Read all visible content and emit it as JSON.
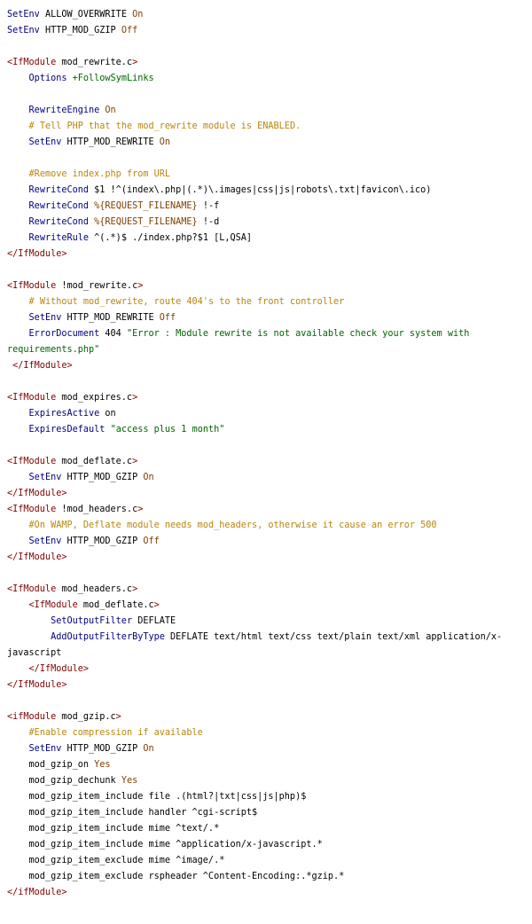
{
  "code": {
    "lines": [
      [
        [
          "d",
          "SetEnv"
        ],
        [
          "p",
          " ALLOW_OVERWRITE "
        ],
        [
          "o",
          "On"
        ]
      ],
      [
        [
          "d",
          "SetEnv"
        ],
        [
          "p",
          " HTTP_MOD_GZIP "
        ],
        [
          "o",
          "Off"
        ]
      ],
      [],
      [
        [
          "t",
          "<IfModule"
        ],
        [
          "p",
          " mod_rewrite.c"
        ],
        [
          "t",
          ">"
        ]
      ],
      [
        [
          "p",
          "    "
        ],
        [
          "d",
          "Options"
        ],
        [
          "p",
          " "
        ],
        [
          "s",
          "+FollowSymLinks"
        ]
      ],
      [],
      [
        [
          "p",
          "    "
        ],
        [
          "d",
          "RewriteEngine"
        ],
        [
          "p",
          " "
        ],
        [
          "o",
          "On"
        ]
      ],
      [
        [
          "p",
          "    "
        ],
        [
          "c",
          "# Tell PHP that the mod_rewrite module is ENABLED."
        ]
      ],
      [
        [
          "p",
          "    "
        ],
        [
          "d",
          "SetEnv"
        ],
        [
          "p",
          " HTTP_MOD_REWRITE "
        ],
        [
          "o",
          "On"
        ]
      ],
      [],
      [
        [
          "p",
          "    "
        ],
        [
          "c",
          "#Remove index.php from URL"
        ]
      ],
      [
        [
          "p",
          "    "
        ],
        [
          "d",
          "RewriteCond"
        ],
        [
          "p",
          " $1 !^(index\\.php|(.*)\\.images|css|js|robots\\.txt|favicon\\.ico)"
        ]
      ],
      [
        [
          "p",
          "    "
        ],
        [
          "d",
          "RewriteCond"
        ],
        [
          "p",
          " "
        ],
        [
          "o",
          "%{REQUEST_FILENAME}"
        ],
        [
          "p",
          " !-f"
        ]
      ],
      [
        [
          "p",
          "    "
        ],
        [
          "d",
          "RewriteCond"
        ],
        [
          "p",
          " "
        ],
        [
          "o",
          "%{REQUEST_FILENAME}"
        ],
        [
          "p",
          " !-d"
        ]
      ],
      [
        [
          "p",
          "    "
        ],
        [
          "d",
          "RewriteRule"
        ],
        [
          "p",
          " ^(.*)$ ./index.php?$1 [L,QSA]"
        ]
      ],
      [
        [
          "t",
          "</IfModule>"
        ]
      ],
      [],
      [
        [
          "t",
          "<IfModule"
        ],
        [
          "p",
          " !mod_rewrite.c"
        ],
        [
          "t",
          ">"
        ]
      ],
      [
        [
          "p",
          "    "
        ],
        [
          "c",
          "# Without mod_rewrite, route 404's to the front controller"
        ]
      ],
      [
        [
          "p",
          "    "
        ],
        [
          "d",
          "SetEnv"
        ],
        [
          "p",
          " HTTP_MOD_REWRITE "
        ],
        [
          "o",
          "Off"
        ]
      ],
      [
        [
          "p",
          "    "
        ],
        [
          "d",
          "ErrorDocument"
        ],
        [
          "p",
          " 404 "
        ],
        [
          "s",
          "\"Error : Module rewrite is not available check your system with"
        ]
      ],
      [
        [
          "s",
          "requirements.php\""
        ]
      ],
      [
        [
          "p",
          " "
        ],
        [
          "t",
          "</IfModule>"
        ]
      ],
      [],
      [
        [
          "t",
          "<IfModule"
        ],
        [
          "p",
          " mod_expires.c"
        ],
        [
          "t",
          ">"
        ]
      ],
      [
        [
          "p",
          "    "
        ],
        [
          "d",
          "ExpiresActive"
        ],
        [
          "p",
          " on"
        ]
      ],
      [
        [
          "p",
          "    "
        ],
        [
          "d",
          "ExpiresDefault"
        ],
        [
          "p",
          " "
        ],
        [
          "s",
          "\"access plus 1 month\""
        ]
      ],
      [],
      [
        [
          "t",
          "<IfModule"
        ],
        [
          "p",
          " mod_deflate.c"
        ],
        [
          "t",
          ">"
        ]
      ],
      [
        [
          "p",
          "    "
        ],
        [
          "d",
          "SetEnv"
        ],
        [
          "p",
          " HTTP_MOD_GZIP "
        ],
        [
          "o",
          "On"
        ]
      ],
      [
        [
          "t",
          "</IfModule>"
        ]
      ],
      [
        [
          "t",
          "<IfModule"
        ],
        [
          "p",
          " !mod_headers.c"
        ],
        [
          "t",
          ">"
        ]
      ],
      [
        [
          "p",
          "    "
        ],
        [
          "c",
          "#On WAMP, Deflate module needs mod_headers, otherwise it cause an error 500"
        ]
      ],
      [
        [
          "p",
          "    "
        ],
        [
          "d",
          "SetEnv"
        ],
        [
          "p",
          " HTTP_MOD_GZIP "
        ],
        [
          "o",
          "Off"
        ]
      ],
      [
        [
          "t",
          "</IfModule>"
        ]
      ],
      [],
      [
        [
          "t",
          "<IfModule"
        ],
        [
          "p",
          " mod_headers.c"
        ],
        [
          "t",
          ">"
        ]
      ],
      [
        [
          "p",
          "    "
        ],
        [
          "t",
          "<IfModule"
        ],
        [
          "p",
          " mod_deflate.c"
        ],
        [
          "t",
          ">"
        ]
      ],
      [
        [
          "p",
          "        "
        ],
        [
          "d",
          "SetOutputFilter"
        ],
        [
          "p",
          " DEFLATE"
        ]
      ],
      [
        [
          "p",
          "        "
        ],
        [
          "d",
          "AddOutputFilterByType"
        ],
        [
          "p",
          " DEFLATE text/html text/css text/plain text/xml application/x-"
        ]
      ],
      [
        [
          "p",
          "javascript"
        ]
      ],
      [
        [
          "p",
          "    "
        ],
        [
          "t",
          "</IfModule>"
        ]
      ],
      [
        [
          "t",
          "</IfModule>"
        ]
      ],
      [],
      [
        [
          "t",
          "<ifModule"
        ],
        [
          "p",
          " mod_gzip.c"
        ],
        [
          "t",
          ">"
        ]
      ],
      [
        [
          "p",
          "    "
        ],
        [
          "c",
          "#Enable compression if available"
        ]
      ],
      [
        [
          "p",
          "    "
        ],
        [
          "d",
          "SetEnv"
        ],
        [
          "p",
          " HTTP_MOD_GZIP "
        ],
        [
          "o",
          "On"
        ]
      ],
      [
        [
          "p",
          "    mod_gzip_on "
        ],
        [
          "o",
          "Yes"
        ]
      ],
      [
        [
          "p",
          "    mod_gzip_dechunk "
        ],
        [
          "o",
          "Yes"
        ]
      ],
      [
        [
          "p",
          "    mod_gzip_item_include file .(html?|txt|css|js|php)$"
        ]
      ],
      [
        [
          "p",
          "    mod_gzip_item_include handler ^cgi-script$"
        ]
      ],
      [
        [
          "p",
          "    mod_gzip_item_include mime ^text/.*"
        ]
      ],
      [
        [
          "p",
          "    mod_gzip_item_include mime ^application/x-javascript.*"
        ]
      ],
      [
        [
          "p",
          "    mod_gzip_item_exclude mime ^image/.*"
        ]
      ],
      [
        [
          "p",
          "    mod_gzip_item_exclude rspheader ^Content-Encoding:.*gzip.*"
        ]
      ],
      [
        [
          "t",
          "</ifModule>"
        ]
      ]
    ]
  }
}
